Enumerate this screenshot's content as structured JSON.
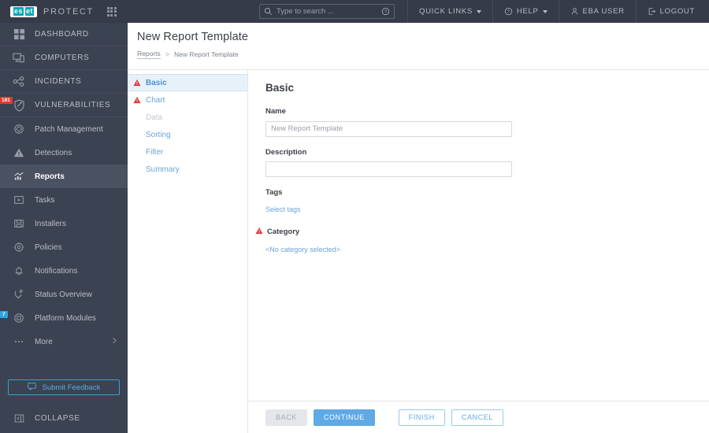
{
  "topbar": {
    "brand_eset": "eset",
    "brand_e": "es",
    "brand_t": "et",
    "brand_product": "PROTECT",
    "grid_icon": "app-grid-icon",
    "search": {
      "placeholder": "Type to search ...",
      "value": "",
      "icon": "search-icon",
      "help_icon": "question-circle-icon"
    },
    "items": [
      {
        "label": "QUICK LINKS",
        "has_caret": true,
        "icon": ""
      },
      {
        "label": "HELP",
        "has_caret": true,
        "icon": "question-circle-icon"
      },
      {
        "label": "EBA USER",
        "has_caret": false,
        "icon": "user-icon"
      },
      {
        "label": "LOGOUT",
        "has_caret": false,
        "icon": "logout-icon"
      }
    ]
  },
  "sidebar": {
    "main_items": [
      {
        "label": "DASHBOARD",
        "icon": "dashboard-grid-icon",
        "active": false,
        "badge": null
      },
      {
        "label": "COMPUTERS",
        "icon": "computers-icon",
        "active": false,
        "badge": null
      },
      {
        "label": "INCIDENTS",
        "icon": "incidents-share-icon",
        "active": false,
        "badge": null
      },
      {
        "label": "VULNERABILITIES",
        "icon": "shield-vulnerability-icon",
        "active": false,
        "badge": "181",
        "badge_color": "#e03a33"
      }
    ],
    "sub_items": [
      {
        "label": "Patch Management",
        "icon": "patch-management-icon",
        "active": false,
        "badge": null
      },
      {
        "label": "Detections",
        "icon": "detections-warning-icon",
        "active": false,
        "badge": null
      },
      {
        "label": "Reports",
        "icon": "reports-chart-icon",
        "active": true,
        "badge": null
      },
      {
        "label": "Tasks",
        "icon": "tasks-play-icon",
        "active": false,
        "badge": null
      },
      {
        "label": "Installers",
        "icon": "installers-save-icon",
        "active": false,
        "badge": null
      },
      {
        "label": "Policies",
        "icon": "policies-gear-icon",
        "active": false,
        "badge": null
      },
      {
        "label": "Notifications",
        "icon": "notifications-bell-icon",
        "active": false,
        "badge": null
      },
      {
        "label": "Status Overview",
        "icon": "status-overview-icon",
        "active": false,
        "badge": null
      },
      {
        "label": "Platform Modules",
        "icon": "platform-modules-icon",
        "active": false,
        "badge": "7",
        "badge_color": "#2fa3e0"
      },
      {
        "label": "More",
        "icon": "more-dots-icon",
        "active": false,
        "badge": null,
        "chevron": true
      }
    ],
    "feedback": {
      "label": "Submit Feedback",
      "icon": "feedback-speech-icon",
      "color": "#59aee4"
    },
    "collapse": {
      "label": "COLLAPSE",
      "icon": "collapse-icon"
    }
  },
  "page": {
    "title": "New Report Template",
    "breadcrumb": {
      "root": "Reports",
      "separator": ">",
      "current": "New Report Template"
    }
  },
  "wizard": {
    "steps": [
      {
        "label": "Basic",
        "state": "selected",
        "warning": true
      },
      {
        "label": "Chart",
        "state": "normal",
        "warning": true
      },
      {
        "label": "Data",
        "state": "disabled",
        "warning": false
      },
      {
        "label": "Sorting",
        "state": "normal",
        "warning": false
      },
      {
        "label": "Filter",
        "state": "normal",
        "warning": false
      },
      {
        "label": "Summary",
        "state": "normal",
        "warning": false
      }
    ]
  },
  "form": {
    "section_title": "Basic",
    "name": {
      "label": "Name",
      "value": "New Report Template",
      "placeholder": "New Report Template"
    },
    "description": {
      "label": "Description",
      "value": "",
      "placeholder": ""
    },
    "tags": {
      "label": "Tags",
      "link": "Select tags"
    },
    "category": {
      "label": "Category",
      "warning": true,
      "link": "<No category selected>"
    }
  },
  "footer": {
    "back": "BACK",
    "continue": "CONTINUE",
    "finish": "FINISH",
    "cancel": "CANCEL"
  },
  "colors": {
    "topbar_bg": "#353b48",
    "sidebar_bg": "#3b4251",
    "sidebar_active": "#4a5161",
    "accent_blue": "#5fa9e5",
    "link_blue": "#6ba4d8",
    "warning_red": "#e03a33",
    "eset_teal": "#00a7b5",
    "step_selected_bg": "#e7f1fa"
  }
}
